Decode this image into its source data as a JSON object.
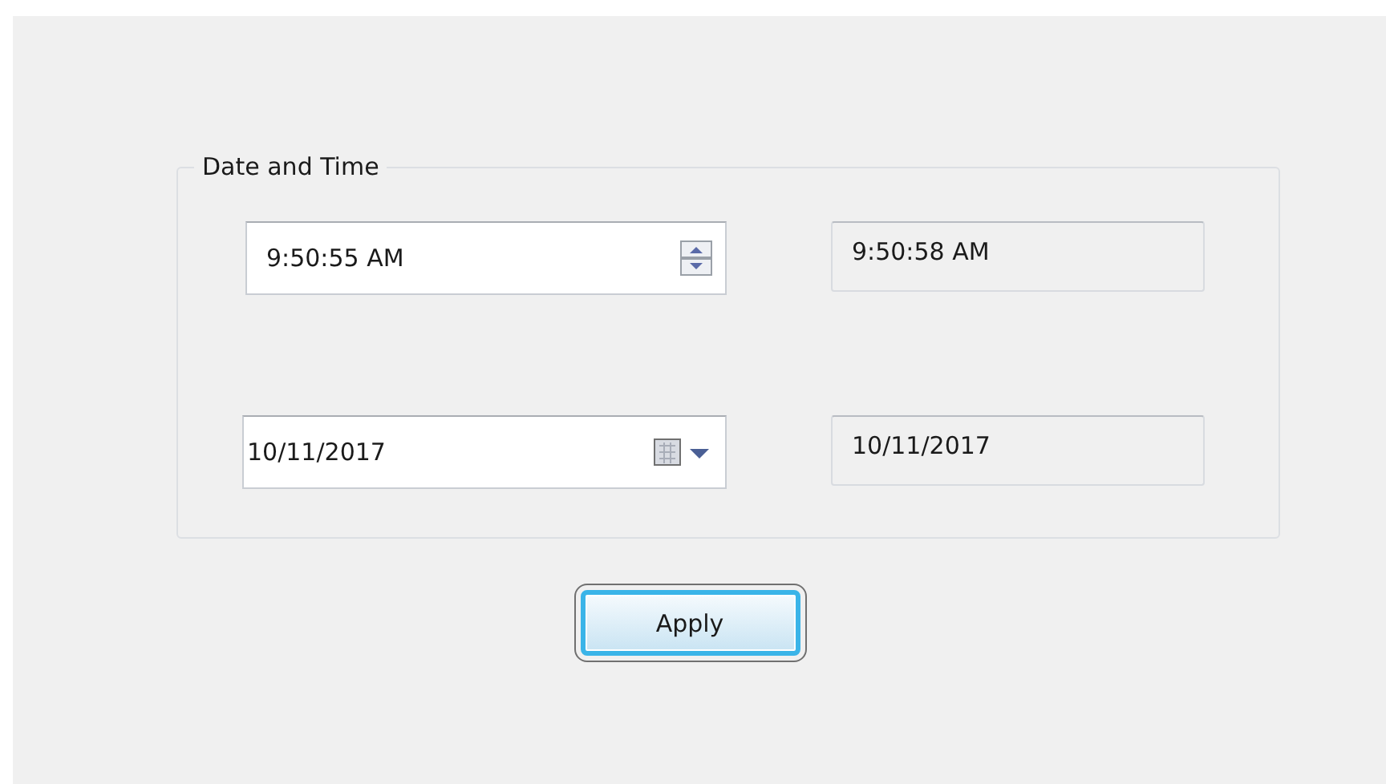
{
  "group": {
    "title": "Date and Time"
  },
  "time_picker": {
    "value": "9:50:55 AM"
  },
  "time_readout": {
    "value": "9:50:58 AM"
  },
  "date_picker": {
    "value": "10/11/2017"
  },
  "date_readout": {
    "value": "10/11/2017"
  },
  "buttons": [
    {
      "label": "Apply"
    }
  ]
}
